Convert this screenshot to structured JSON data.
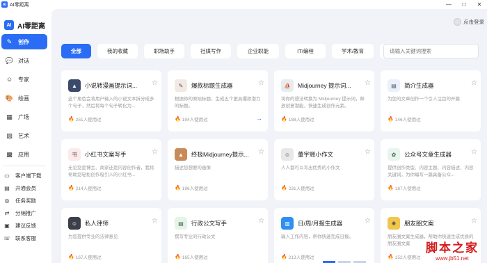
{
  "window": {
    "title": "AI零距离",
    "app_icon": "AI",
    "controls": [
      "—",
      "□",
      "✕"
    ]
  },
  "brand": {
    "logo": "AI",
    "name": "AI零距离"
  },
  "sidebar": {
    "main_items": [
      {
        "label": "创作",
        "icon": "pencil-icon",
        "glyph": "✎"
      },
      {
        "label": "对话",
        "icon": "chat-icon",
        "glyph": "💬"
      },
      {
        "label": "专家",
        "icon": "expert-icon",
        "glyph": "☺"
      },
      {
        "label": "绘画",
        "icon": "paint-icon",
        "glyph": "🎨"
      },
      {
        "label": "广场",
        "icon": "square-icon",
        "glyph": "▦"
      },
      {
        "label": "艺术",
        "icon": "art-icon",
        "glyph": "▨"
      },
      {
        "label": "应用",
        "icon": "apps-icon",
        "glyph": "▩"
      }
    ],
    "secondary_items": [
      {
        "label": "客户端下载",
        "icon": "download-icon",
        "glyph": "▭"
      },
      {
        "label": "开通会员",
        "icon": "vip-icon",
        "glyph": "▤"
      },
      {
        "label": "任务奖励",
        "icon": "reward-icon",
        "glyph": "◎"
      },
      {
        "label": "分销推广",
        "icon": "share-icon",
        "glyph": "⇄"
      },
      {
        "label": "建议反馈",
        "icon": "feedback-icon",
        "glyph": "▣"
      },
      {
        "label": "联系客服",
        "icon": "service-icon",
        "glyph": "☏"
      }
    ]
  },
  "header": {
    "login_label": "点击登录"
  },
  "tabs": [
    "全部",
    "我的收藏",
    "职场助手",
    "社媒写作",
    "企业职能",
    "IT/编程",
    "学术/教育",
    ""
  ],
  "search": {
    "placeholder": "请输入关键词搜索"
  },
  "cards": [
    {
      "title": "小说转漫画提示词...",
      "desc": "这个角色会将用户输入的小说文本拆分成多个句子，然后将每个句子转化为...",
      "uses": "251人使用过",
      "icon": "novel-comic-icon",
      "icon_color": "#3b4a6b",
      "glyph": "▲"
    },
    {
      "title": "爆款标题生成器",
      "desc": "根据你的原始标题，生成五个更具爆款潜力的标题。",
      "uses": "194人使用过",
      "icon": "headline-icon",
      "icon_color": "#f3e9e4",
      "glyph": "✎"
    },
    {
      "title": "Midjourney 提示词...",
      "desc": "将你的想法转换为 Midjourney 提示词，释放创意潜能，快速生成创作元素。",
      "uses": "188人使用过",
      "icon": "midjourney-icon",
      "icon_color": "#e9ecef",
      "glyph": "⛵"
    },
    {
      "title": "简介生成器",
      "desc": "为您的文章创作一个引人注目的开篇",
      "uses": "146人使用过",
      "icon": "intro-icon",
      "icon_color": "#eaf1fd",
      "glyph": "▤"
    },
    {
      "title": "小红书文案写手",
      "desc": "无论您是博主、商家还是内容创作者，我将帮助您轻松创作吸引人的小红书...",
      "uses": "214人使用过",
      "icon": "xiaohongshu-icon",
      "icon_color": "#fdeaea",
      "glyph": "书"
    },
    {
      "title": "终极Midjourney提示...",
      "desc": "描述您想要的画像",
      "uses": "196人使用过",
      "icon": "ultimate-mj-icon",
      "icon_color": "#c98a5a",
      "glyph": "▲"
    },
    {
      "title": "董宇辉小作文",
      "desc": "人人都可以写出优秀的小作文",
      "uses": "231人使用过",
      "icon": "essay-icon",
      "icon_color": "#e8e8e8",
      "glyph": "☺"
    },
    {
      "title": "公众号文章生成器",
      "desc": "提供创作类型、内容主题、内容描述、内容关键词，为你编写一篇具备公众...",
      "uses": "187人使用过",
      "icon": "wechat-article-icon",
      "icon_color": "#e7f6ec",
      "glyph": "✿"
    },
    {
      "title": "私人律师",
      "desc": "为您提供专业的法律意见",
      "uses": "167人使用过",
      "icon": "lawyer-icon",
      "icon_color": "#3a3f4a",
      "glyph": "☺"
    },
    {
      "title": "行政公文写手",
      "desc": "撰写专业的行政公文",
      "uses": "165人使用过",
      "icon": "official-doc-icon",
      "icon_color": "#e3f5e6",
      "glyph": "▤"
    },
    {
      "title": "日/周/月报生成器",
      "desc": "输入工作内容，帮你快速完成日报。",
      "uses": "213人使用过",
      "icon": "report-icon",
      "icon_color": "#2f8ff0",
      "glyph": "▥"
    },
    {
      "title": "朋友圈文案",
      "desc": "朋友圈文案生成器，帮助你快速生成优质的朋友圈文案",
      "uses": "152人使用过",
      "icon": "moments-icon",
      "icon_color": "#f2c64a",
      "glyph": "✺"
    }
  ],
  "watermark": {
    "title": "脚本之家",
    "url": "www.jb51.net"
  }
}
